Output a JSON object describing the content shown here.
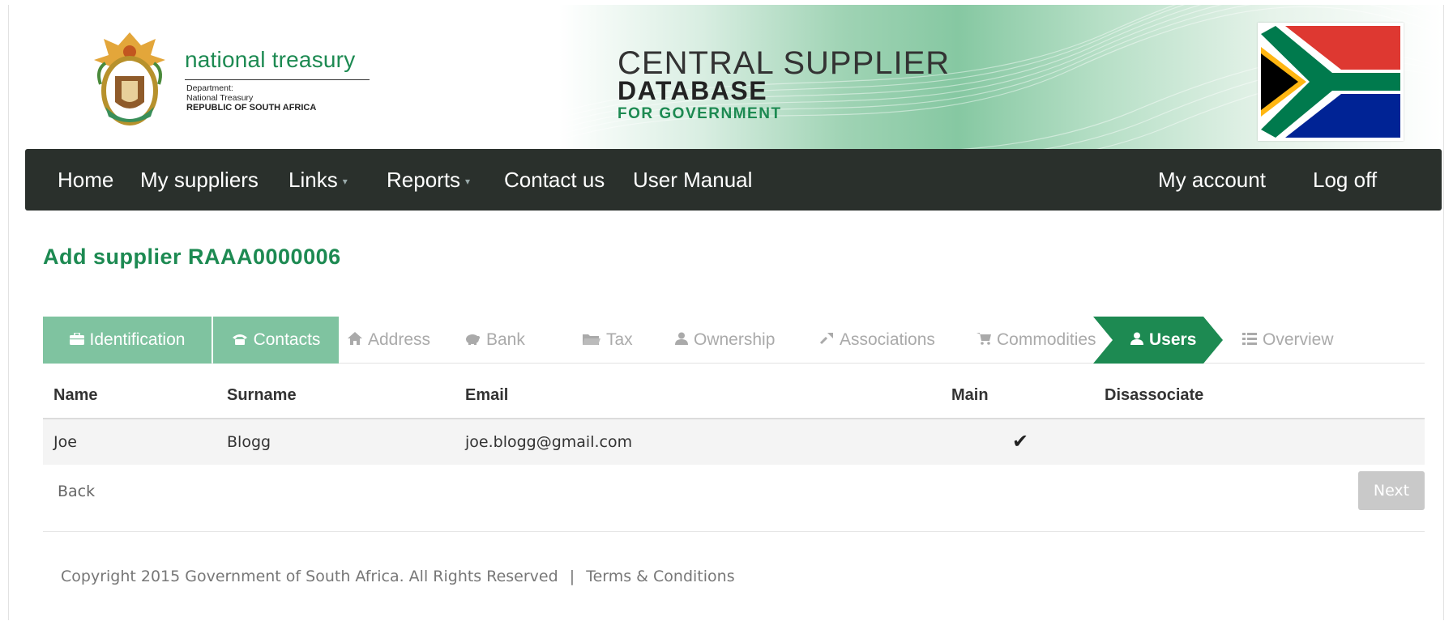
{
  "header": {
    "dept_title": "national treasury",
    "dept_line1": "Department:",
    "dept_line2": "National Treasury",
    "dept_line3": "REPUBLIC OF SOUTH AFRICA",
    "app_line1": "CENTRAL SUPPLIER",
    "app_line2": "DATABASE",
    "app_line3": "FOR GOVERNMENT"
  },
  "nav": {
    "items": [
      {
        "label": "Home"
      },
      {
        "label": "My suppliers"
      },
      {
        "label": "Links",
        "dropdown": true
      },
      {
        "label": "Reports",
        "dropdown": true
      },
      {
        "label": "Contact us"
      },
      {
        "label": "User Manual"
      }
    ],
    "right": [
      {
        "label": "My account"
      },
      {
        "label": "Log off"
      }
    ],
    "caret": "▾"
  },
  "page_title": "Add supplier RAAA0000006",
  "steps": [
    {
      "label": "Identification",
      "icon": "briefcase-icon",
      "state": "done"
    },
    {
      "label": "Contacts",
      "icon": "phone-icon",
      "state": "done"
    },
    {
      "label": "Address",
      "icon": "home-icon",
      "state": "pending"
    },
    {
      "label": "Bank",
      "icon": "piggy-bank-icon",
      "state": "pending"
    },
    {
      "label": "Tax",
      "icon": "folder-icon",
      "state": "pending"
    },
    {
      "label": "Ownership",
      "icon": "user-icon",
      "state": "pending"
    },
    {
      "label": "Associations",
      "icon": "link-icon",
      "state": "pending"
    },
    {
      "label": "Commodities",
      "icon": "cart-icon",
      "state": "pending"
    },
    {
      "label": "Users",
      "icon": "user-icon",
      "state": "active"
    },
    {
      "label": "Overview",
      "icon": "list-icon",
      "state": "pending"
    }
  ],
  "table": {
    "headers": [
      "Name",
      "Surname",
      "Email",
      "Main",
      "Disassociate"
    ],
    "rows": [
      {
        "name": "Joe",
        "surname": "Blogg",
        "email": "joe.blogg@gmail.com",
        "main": "✔",
        "disassociate": ""
      }
    ]
  },
  "actions": {
    "back_label": "Back",
    "next_label": "Next"
  },
  "footer": {
    "copyright": "Copyright 2015 Government of South Africa. All Rights Reserved",
    "separator": "|",
    "terms": "Terms & Conditions"
  },
  "colors": {
    "brand_green": "#1d8a52",
    "step_done": "#7fc3a0",
    "step_active": "#1d8a52",
    "navbar": "#2a302c"
  }
}
